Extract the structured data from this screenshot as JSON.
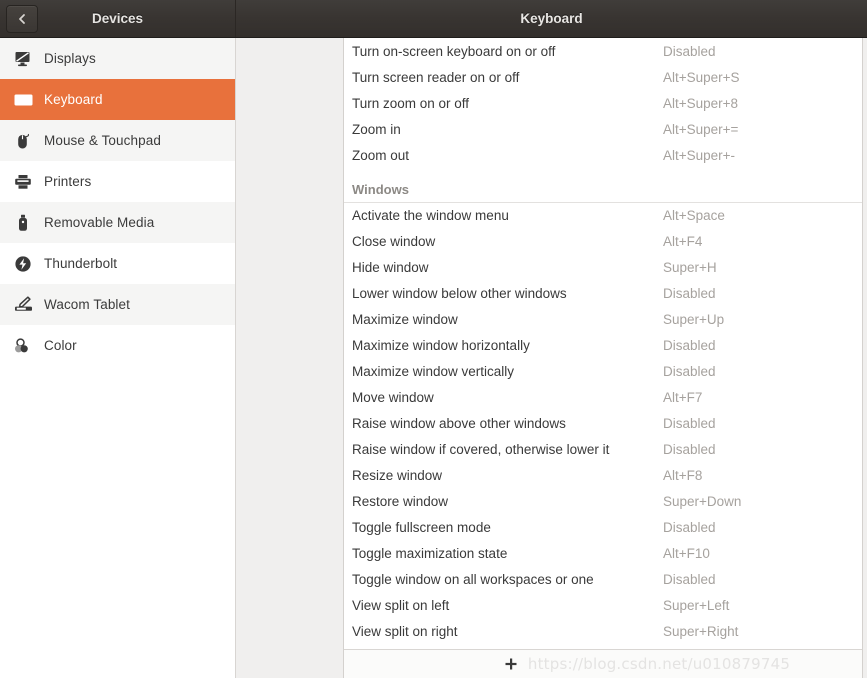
{
  "header": {
    "back_icon": "chevron-left-icon",
    "left_title": "Devices",
    "right_title": "Keyboard"
  },
  "sidebar": {
    "items": [
      {
        "label": "Displays",
        "icon": "display-icon",
        "selected": false,
        "shade": "alt"
      },
      {
        "label": "Keyboard",
        "icon": "keyboard-icon",
        "selected": true,
        "shade": "plain"
      },
      {
        "label": "Mouse & Touchpad",
        "icon": "mouse-icon",
        "selected": false,
        "shade": "alt"
      },
      {
        "label": "Printers",
        "icon": "printer-icon",
        "selected": false,
        "shade": "plain"
      },
      {
        "label": "Removable Media",
        "icon": "usb-drive-icon",
        "selected": false,
        "shade": "alt"
      },
      {
        "label": "Thunderbolt",
        "icon": "thunderbolt-icon",
        "selected": false,
        "shade": "plain"
      },
      {
        "label": "Wacom Tablet",
        "icon": "wacom-tablet-icon",
        "selected": false,
        "shade": "alt"
      },
      {
        "label": "Color",
        "icon": "color-profile-icon",
        "selected": false,
        "shade": "plain"
      }
    ]
  },
  "shortcuts": {
    "rows": [
      {
        "type": "row",
        "name": "Turn on-screen keyboard on or off",
        "accel": "Disabled"
      },
      {
        "type": "row",
        "name": "Turn screen reader on or off",
        "accel": "Alt+Super+S"
      },
      {
        "type": "row",
        "name": "Turn zoom on or off",
        "accel": "Alt+Super+8"
      },
      {
        "type": "row",
        "name": "Zoom in",
        "accel": "Alt+Super+="
      },
      {
        "type": "row",
        "name": "Zoom out",
        "accel": "Alt+Super+-"
      },
      {
        "type": "section",
        "name": "Windows",
        "accel": ""
      },
      {
        "type": "row",
        "name": "Activate the window menu",
        "accel": "Alt+Space"
      },
      {
        "type": "row",
        "name": "Close window",
        "accel": "Alt+F4"
      },
      {
        "type": "row",
        "name": "Hide window",
        "accel": "Super+H"
      },
      {
        "type": "row",
        "name": "Lower window below other windows",
        "accel": "Disabled"
      },
      {
        "type": "row",
        "name": "Maximize window",
        "accel": "Super+Up"
      },
      {
        "type": "row",
        "name": "Maximize window horizontally",
        "accel": "Disabled"
      },
      {
        "type": "row",
        "name": "Maximize window vertically",
        "accel": "Disabled"
      },
      {
        "type": "row",
        "name": "Move window",
        "accel": "Alt+F7"
      },
      {
        "type": "row",
        "name": "Raise window above other windows",
        "accel": "Disabled"
      },
      {
        "type": "row",
        "name": "Raise window if covered, otherwise lower it",
        "accel": "Disabled"
      },
      {
        "type": "row",
        "name": "Resize window",
        "accel": "Alt+F8"
      },
      {
        "type": "row",
        "name": "Restore window",
        "accel": "Super+Down"
      },
      {
        "type": "row",
        "name": "Toggle fullscreen mode",
        "accel": "Disabled"
      },
      {
        "type": "row",
        "name": "Toggle maximization state",
        "accel": "Alt+F10"
      },
      {
        "type": "row",
        "name": "Toggle window on all workspaces or one",
        "accel": "Disabled"
      },
      {
        "type": "row",
        "name": "View split on left",
        "accel": "Super+Left"
      },
      {
        "type": "row",
        "name": "View split on right",
        "accel": "Super+Right"
      }
    ]
  },
  "toolbar": {
    "add_icon": "plus-icon",
    "watermark": "https://blog.csdn.net/u010879745"
  },
  "colors": {
    "selection": "#e8713c",
    "header_bg": "#383431",
    "accel_text": "#a6a29e",
    "row_text": "#3a3a3a"
  }
}
